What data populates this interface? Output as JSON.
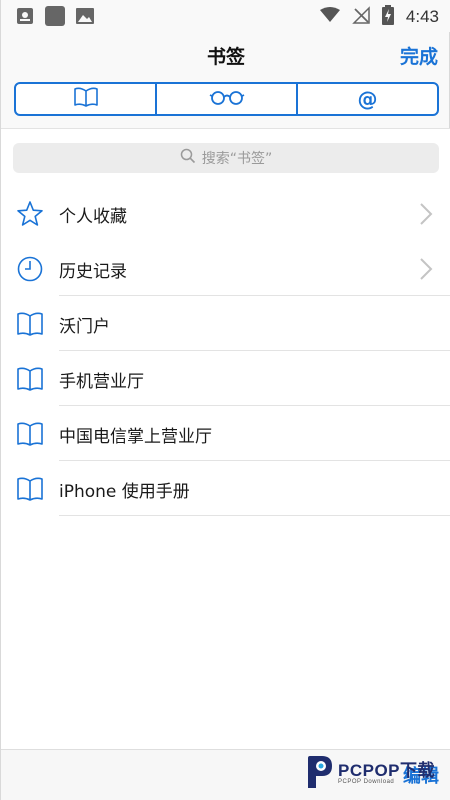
{
  "status_bar": {
    "time": "4:43",
    "left_icons": [
      "notification-icon",
      "app-square-icon",
      "image-icon"
    ],
    "right_icons": [
      "wifi-icon",
      "no-signal-icon",
      "battery-charging-icon"
    ]
  },
  "navbar": {
    "title": "书签",
    "done_label": "完成"
  },
  "segmented": {
    "tabs": [
      {
        "icon": "book-icon",
        "selected": true
      },
      {
        "icon": "reading-glasses-icon",
        "selected": false
      },
      {
        "icon": "at-sign-icon",
        "label": "@",
        "selected": false
      }
    ]
  },
  "search": {
    "placeholder": "搜索“书签”"
  },
  "bookmarks": [
    {
      "label": "个人收藏",
      "icon": "star-icon",
      "has_chevron": true
    },
    {
      "label": "历史记录",
      "icon": "clock-icon",
      "has_chevron": true
    },
    {
      "label": "沃门户",
      "icon": "book-icon",
      "has_chevron": false
    },
    {
      "label": "手机营业厅",
      "icon": "book-icon",
      "has_chevron": false
    },
    {
      "label": "中国电信掌上营业厅",
      "icon": "book-icon",
      "has_chevron": false
    },
    {
      "label": "iPhone 使用手册",
      "icon": "book-icon",
      "has_chevron": false
    }
  ],
  "toolbar": {
    "edit_label": "编辑"
  },
  "watermark": {
    "brand": "PCPOP下载",
    "sub": "PCPOP Download"
  },
  "colors": {
    "accent": "#1a73d6",
    "background": "#ffffff",
    "separator": "#e3e3e3"
  }
}
